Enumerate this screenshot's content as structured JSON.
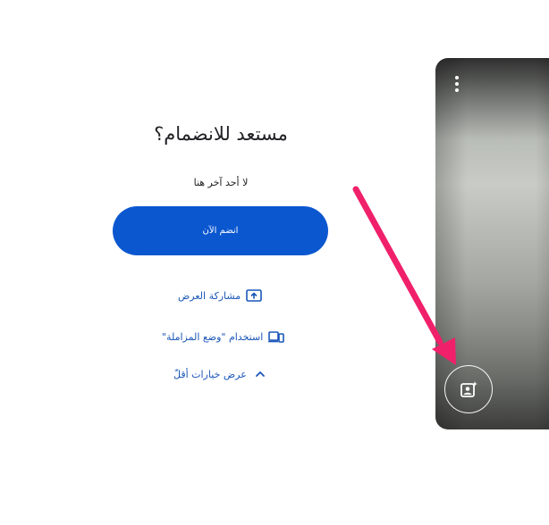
{
  "join": {
    "title": "مستعد للانضمام؟",
    "subtitle": "لا أحد آخر هنا",
    "join_button_label": "انضم الآن"
  },
  "actions": {
    "present_label": "مشاركة العرض",
    "companion_label": "استخدام \"وضع المزاملة\"",
    "more_options_label": "عرض خيارات أقلّ"
  },
  "preview": {
    "more_options_icon": "more-vert-icon",
    "effects_icon": "visual-effects-icon"
  },
  "colors": {
    "accent": "#0b57d0",
    "link": "#1a56b8",
    "annotation_arrow": "#f0206a"
  }
}
